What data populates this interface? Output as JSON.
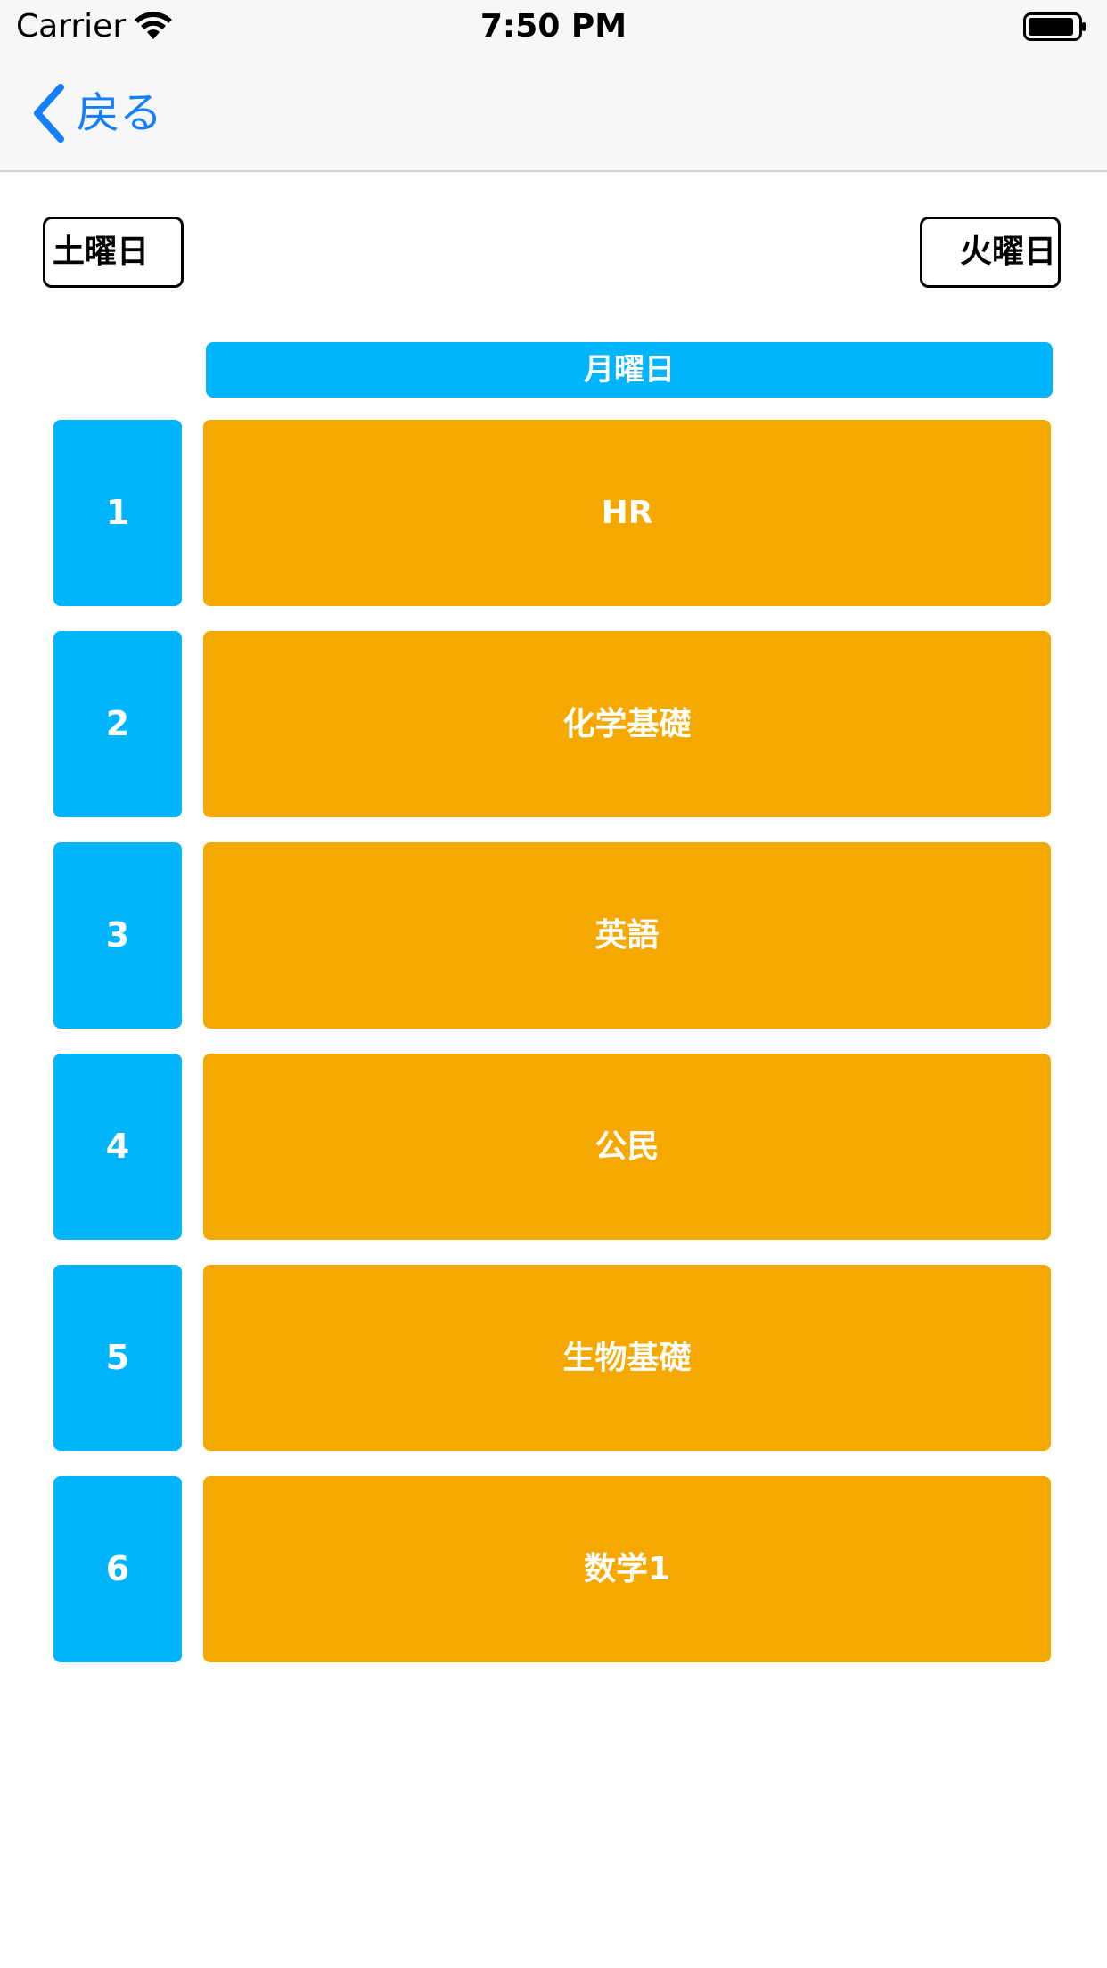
{
  "status_bar": {
    "carrier": "Carrier",
    "time": "7:50 PM"
  },
  "nav": {
    "back_label": "戻る"
  },
  "day_nav": {
    "prev_label": "土曜日",
    "next_label": "火曜日",
    "current_day": "月曜日"
  },
  "periods": [
    {
      "number": "1",
      "subject": "HR"
    },
    {
      "number": "2",
      "subject": "化学基礎"
    },
    {
      "number": "3",
      "subject": "英語"
    },
    {
      "number": "4",
      "subject": "公民"
    },
    {
      "number": "5",
      "subject": "生物基礎"
    },
    {
      "number": "6",
      "subject": "数学1"
    }
  ],
  "colors": {
    "accent_blue": "#00b5fb",
    "subject_orange": "#f5a800",
    "ios_blue": "#157efb"
  }
}
